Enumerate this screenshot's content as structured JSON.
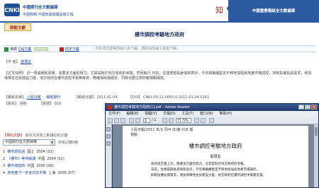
{
  "header": {
    "logo_mark": "CNKI",
    "logo_name": "中國期刊全文數據庫",
    "logo_sub": "中國知網 中國知識基礎設施工程",
    "product": "中國重要報紙全文數據庫"
  },
  "tag_button": "節點文獻",
  "article_title": "樓市調控考驗地方政府",
  "download_bar": {
    "caj_label": "推薦",
    "caj_link": "CAJ下載",
    "pdf_link": "PDF下載",
    "hint": "不支持迅雷等加速工具下載，請取消加速工具後下載。"
  },
  "meta": {
    "author_key": "【作 者】",
    "author_value": "劉璞友",
    "abstract_key": "【正文快照】",
    "abstract_text": "近一周滬穗民政黨，需要多方面的努力；尤其是對於地方政府的考驗，然而執行 日前，住建部部長姜偉新表示，今年將繼續堅定不移地加強房地產市場調控，抑制投機投資需求，增加保障性住房建設力度，地方政府在樓市調控中責無旁貸，應確保房價穩定，同時也要注意防範相關風險。",
    "pub_key": "【報紙名稱】",
    "pub_value": "人民日報",
    "pub_link": "報紙期刊",
    "date_key": "【報紙日期】",
    "date_value": "2011-01-04",
    "doi_key": "【DOI】",
    "doi_value": "CNKI:CN:11-0065.0.2011-01-04.0161",
    "col_key": "【版名】",
    "col_value": "視點",
    "page_key": "【版號】",
    "page_value": "016"
  },
  "left_panel": {
    "title": "【相似文獻】",
    "subtitle": "與本文內容上較接近的文獻",
    "select_value": "中國期刊全文數據庫",
    "count": "共有記錄5條",
    "items": [
      {
        "num": "1",
        "title": "樓市調控過",
        "src": "國土",
        "year": "2004 (S1)"
      },
      {
        "num": "2",
        "title": "《樓市》等待解讀",
        "src": "中國",
        "year": "2004 (S1)"
      },
      {
        "num": "3",
        "title": "樓市總結和",
        "src": "中國",
        "year": "2005 (06)"
      },
      {
        "num": "4",
        "title": "房地產下一步走向在市場",
        "src": "上海",
        "year": "2005 (07)"
      }
    ]
  },
  "reader": {
    "window_title": "樓市調控考驗地方政府[1].pdf - Adobe Reader",
    "menu": [
      "文件(F)",
      "編輯(E)",
      "視圖(V)",
      "文檔(D)",
      "工具(T)",
      "窗口(W)",
      "幫助(H)"
    ],
    "page_current": "1",
    "page_total": "/ 1",
    "zoom": "71.5%",
    "page_header_line1": "人民日報/2011 年/1 月/4 日/第 016 版",
    "page_header_line2": "視點",
    "page_title": "樓市調控考驗地方政府",
    "page_author": "劉璞友",
    "page_body": [
      "　　新房成交量上升，需要多方面的努力，尤其是對於地方政府的考驗。",
      "　　日前，住建部部長姜偉新表示，今年將繼續堅定不移地加強房地產市場調控，",
      "　　抑制投機投資需求，增加保障性住房建設力度，地方政府在樓市調控中責無旁貸。"
    ]
  }
}
